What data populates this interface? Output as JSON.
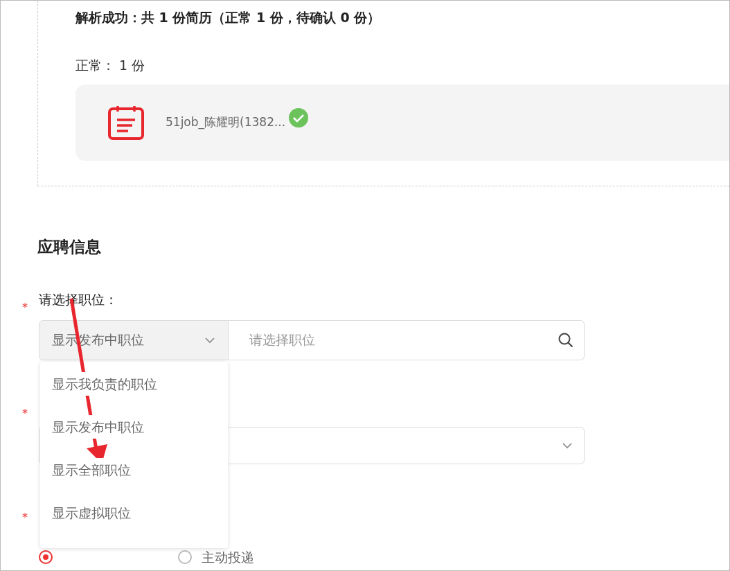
{
  "parse_result": {
    "summary": "解析成功：共 1 份简历（正常 1 份，待确认 0 份）",
    "normal_count": "正常： 1 份",
    "files": [
      {
        "name": "51job_陈耀明(1382...",
        "verified": true
      }
    ]
  },
  "section_title": "应聘信息",
  "fields": [
    {
      "kind": "position",
      "required_mark": "*",
      "label": "请选择职位：",
      "filter": "显示发布中职位",
      "placeholder": "请选择职位",
      "options": [
        "显示我负责的职位",
        "显示发布中职位",
        "显示全部职位",
        "显示虚拟职位"
      ]
    },
    {
      "kind": "select",
      "required_mark": "*"
    },
    {
      "kind": "radios",
      "required_mark": "*",
      "radios": [
        {
          "selected": true
        },
        {
          "label": "主动投递",
          "selected": false
        }
      ]
    }
  ]
}
